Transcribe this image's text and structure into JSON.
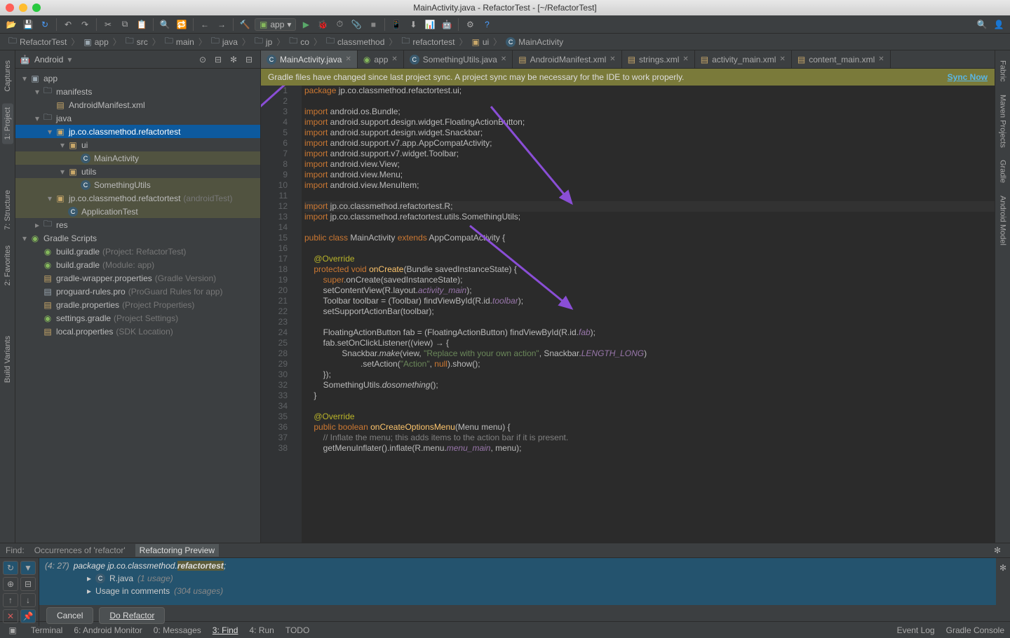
{
  "title": "MainActivity.java - RefactorTest - [~/RefactorTest]",
  "runConfig": "app",
  "breadcrumb": [
    "RefactorTest",
    "app",
    "src",
    "main",
    "java",
    "jp",
    "co",
    "classmethod",
    "refactortest",
    "ui",
    "MainActivity"
  ],
  "projectView": "Android",
  "tree": [
    {
      "d": 0,
      "ic": "mod",
      "txt": "app",
      "arr": "▾"
    },
    {
      "d": 1,
      "ic": "fld",
      "txt": "manifests",
      "arr": "▾"
    },
    {
      "d": 2,
      "ic": "xml",
      "txt": "AndroidManifest.xml"
    },
    {
      "d": 1,
      "ic": "fld",
      "txt": "java",
      "arr": "▾"
    },
    {
      "d": 2,
      "ic": "pkg",
      "txt": "jp.co.classmethod.refactortest",
      "arr": "▾",
      "sel": true
    },
    {
      "d": 3,
      "ic": "pkg",
      "txt": "ui",
      "arr": "▾"
    },
    {
      "d": 4,
      "ic": "cls",
      "txt": "MainActivity",
      "hl": true
    },
    {
      "d": 3,
      "ic": "pkg",
      "txt": "utils",
      "arr": "▾"
    },
    {
      "d": 4,
      "ic": "cls",
      "txt": "SomethingUtils",
      "hl": true
    },
    {
      "d": 2,
      "ic": "pkg",
      "txt": "jp.co.classmethod.refactortest",
      "dim": "(androidTest)",
      "arr": "▾",
      "hl": true
    },
    {
      "d": 3,
      "ic": "cls",
      "txt": "ApplicationTest",
      "hl": true
    },
    {
      "d": 1,
      "ic": "fld",
      "txt": "res",
      "arr": "▸"
    },
    {
      "d": 0,
      "ic": "grd",
      "txt": "Gradle Scripts",
      "arr": "▾"
    },
    {
      "d": 1,
      "ic": "grd",
      "txt": "build.gradle",
      "dim": "(Project: RefactorTest)"
    },
    {
      "d": 1,
      "ic": "grd",
      "txt": "build.gradle",
      "dim": "(Module: app)"
    },
    {
      "d": 1,
      "ic": "prp",
      "txt": "gradle-wrapper.properties",
      "dim": "(Gradle Version)"
    },
    {
      "d": 1,
      "ic": "pro",
      "txt": "proguard-rules.pro",
      "dim": "(ProGuard Rules for app)"
    },
    {
      "d": 1,
      "ic": "prp",
      "txt": "gradle.properties",
      "dim": "(Project Properties)"
    },
    {
      "d": 1,
      "ic": "grd",
      "txt": "settings.gradle",
      "dim": "(Project Settings)"
    },
    {
      "d": 1,
      "ic": "prp",
      "txt": "local.properties",
      "dim": "(SDK Location)"
    }
  ],
  "tabs": [
    {
      "ic": "cls",
      "txt": "MainActivity.java",
      "active": true
    },
    {
      "ic": "grd",
      "txt": "app"
    },
    {
      "ic": "cls",
      "txt": "SomethingUtils.java"
    },
    {
      "ic": "xml",
      "txt": "AndroidManifest.xml"
    },
    {
      "ic": "xml",
      "txt": "strings.xml"
    },
    {
      "ic": "xml",
      "txt": "activity_main.xml"
    },
    {
      "ic": "xml",
      "txt": "content_main.xml"
    }
  ],
  "banner": {
    "msg": "Gradle files have changed since last project sync. A project sync may be necessary for the IDE to work properly.",
    "link": "Sync Now"
  },
  "code": [
    {
      "n": 1,
      "h": "<span class=k>package</span> jp.co.classmethod.refactortest.ui;"
    },
    {
      "n": 2,
      "h": ""
    },
    {
      "n": 3,
      "h": "<span class=k>import</span> android.os.Bundle;"
    },
    {
      "n": 4,
      "h": "<span class=k>import</span> android.support.design.widget.FloatingActionButton;"
    },
    {
      "n": 5,
      "h": "<span class=k>import</span> android.support.design.widget.Snackbar;"
    },
    {
      "n": 6,
      "h": "<span class=k>import</span> android.support.v7.app.AppCompatActivity;"
    },
    {
      "n": 7,
      "h": "<span class=k>import</span> android.support.v7.widget.Toolbar;"
    },
    {
      "n": 8,
      "h": "<span class=k>import</span> android.view.View;"
    },
    {
      "n": 9,
      "h": "<span class=k>import</span> android.view.Menu;"
    },
    {
      "n": 10,
      "h": "<span class=k>import</span> android.view.MenuItem;"
    },
    {
      "n": 11,
      "h": ""
    },
    {
      "n": 12,
      "h": "<span class=k>import</span> jp.co.classmethod.refactortest.R;",
      "caret": true
    },
    {
      "n": 13,
      "h": "<span class=k>import</span> jp.co.classmethod.refactortest.utils.SomethingUtils;"
    },
    {
      "n": 14,
      "h": ""
    },
    {
      "n": 15,
      "h": "<span class=k>public class</span> MainActivity <span class=k>extends</span> AppCompatActivity {"
    },
    {
      "n": 16,
      "h": ""
    },
    {
      "n": 17,
      "h": "    <span class=a>@Override</span>"
    },
    {
      "n": 18,
      "h": "    <span class=k>protected void</span> <span class=m>onCreate</span>(Bundle savedInstanceState) {"
    },
    {
      "n": 19,
      "h": "        <span class=k>super</span>.onCreate(savedInstanceState);"
    },
    {
      "n": 20,
      "h": "        setContentView(R.layout.<span class=it>activity_main</span>);"
    },
    {
      "n": 21,
      "h": "        Toolbar toolbar = (Toolbar) findViewById(R.id.<span class=it>toolbar</span>);"
    },
    {
      "n": 22,
      "h": "        setSupportActionBar(toolbar);"
    },
    {
      "n": 23,
      "h": ""
    },
    {
      "n": 24,
      "h": "        FloatingActionButton fab = (FloatingActionButton) findViewById(R.id.<span class=it>fab</span>);"
    },
    {
      "n": 25,
      "h": "        fab.setOnClickListener((view) → {"
    },
    {
      "n": 28,
      "h": "                Snackbar.<span style='font-style:italic'>make</span>(view, <span class=s>\"Replace with your own action\"</span>, Snackbar.<span class=it>LENGTH_LONG</span>)"
    },
    {
      "n": 29,
      "h": "                        .setAction(<span class=s>\"Action\"</span>, <span class=k>null</span>).show();"
    },
    {
      "n": 30,
      "h": "        });"
    },
    {
      "n": 32,
      "h": "        SomethingUtils.<span style='font-style:italic'>dosomething</span>();"
    },
    {
      "n": 33,
      "h": "    }"
    },
    {
      "n": 34,
      "h": ""
    },
    {
      "n": 35,
      "h": "    <span class=a>@Override</span>"
    },
    {
      "n": 36,
      "h": "    <span class=k>public boolean</span> <span class=m>onCreateOptionsMenu</span>(Menu menu) {"
    },
    {
      "n": 37,
      "h": "        <span class=c>// Inflate the menu; this adds items to the action bar if it is present.</span>"
    },
    {
      "n": 38,
      "h": "        getMenuInflater().inflate(R.menu.<span class=it>menu_main</span>, menu);"
    }
  ],
  "find": {
    "tabs": [
      "Find:",
      "Occurrences of 'refactor'",
      "Refactoring Preview"
    ],
    "header": "(4: 27) package jp.co.classmethod.refactortest;",
    "rows": [
      {
        "ic": "cls",
        "txt": "R.java",
        "dim": "(1 usage)",
        "arr": "▸"
      },
      {
        "txt": "Usage in comments",
        "dim": "(304 usages)",
        "arr": "▸"
      }
    ],
    "cancel": "Cancel",
    "doRefactor": "Do Refactor"
  },
  "status": {
    "left": [
      "Terminal",
      "6: Android Monitor",
      "0: Messages",
      "3: Find",
      "4: Run",
      "TODO"
    ],
    "right": [
      "Event Log",
      "Gradle Console"
    ]
  },
  "leftTabs": [
    "Captures",
    "1: Project",
    "7: Structure",
    "2: Favorites",
    "Build Variants"
  ],
  "rightTabs": [
    "Fabric",
    "Maven Projects",
    "Gradle",
    "Android Model"
  ]
}
